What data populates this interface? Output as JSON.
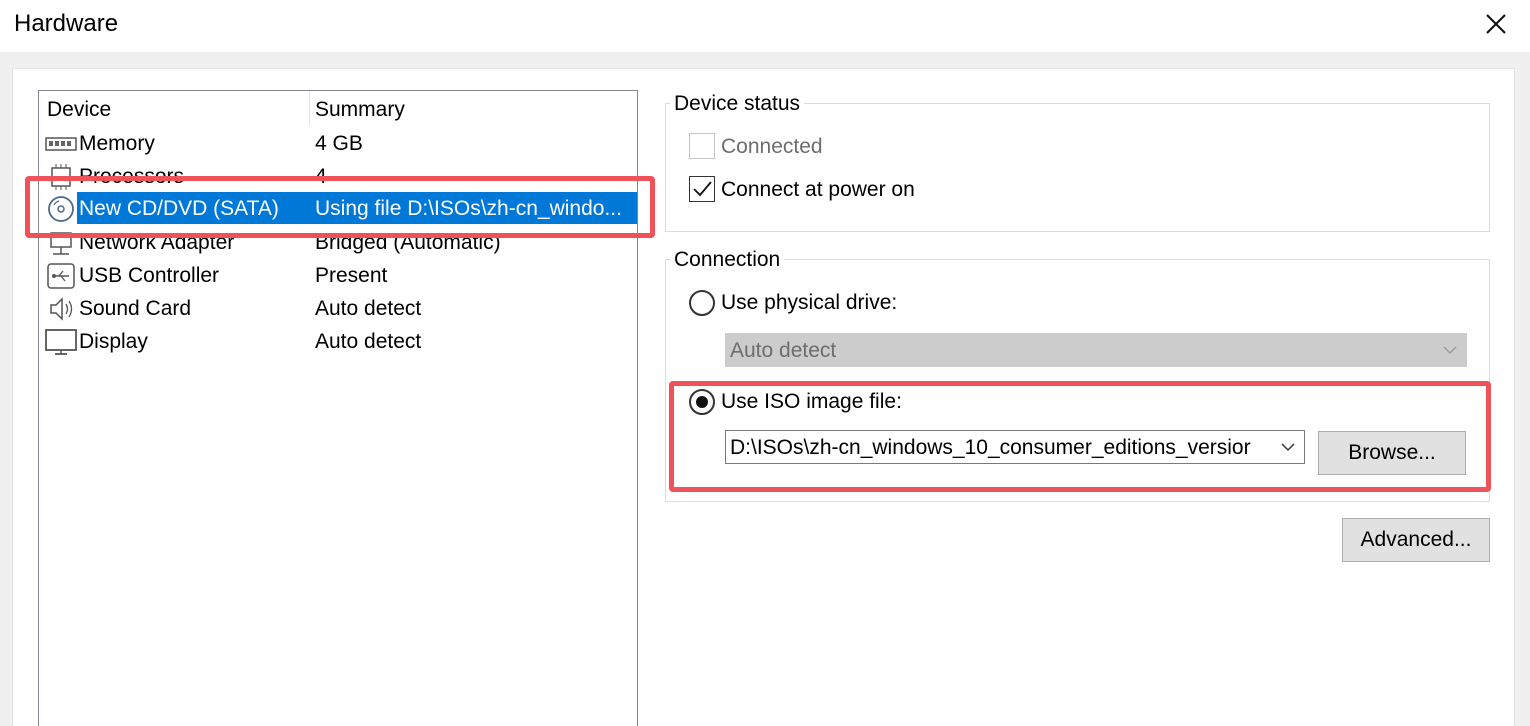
{
  "window": {
    "title": "Hardware",
    "close_icon": "close-icon"
  },
  "device_list": {
    "columns": [
      "Device",
      "Summary"
    ],
    "rows": [
      {
        "icon": "memory-icon",
        "name": "Memory",
        "summary": "4 GB"
      },
      {
        "icon": "processor-icon",
        "name": "Processors",
        "summary": "4"
      },
      {
        "icon": "cd-dvd-icon",
        "name": "New CD/DVD (SATA)",
        "summary": "Using file D:\\ISOs\\zh-cn_windo...",
        "selected": true
      },
      {
        "icon": "network-icon",
        "name": "Network Adapter",
        "summary": "Bridged (Automatic)"
      },
      {
        "icon": "usb-icon",
        "name": "USB Controller",
        "summary": "Present"
      },
      {
        "icon": "speaker-icon",
        "name": "Sound Card",
        "summary": "Auto detect"
      },
      {
        "icon": "monitor-icon",
        "name": "Display",
        "summary": "Auto detect"
      }
    ]
  },
  "device_status": {
    "label": "Device status",
    "connected": {
      "label": "Connected",
      "checked": false,
      "enabled": false
    },
    "connect_at_power_on": {
      "label": "Connect at power on",
      "checked": true
    }
  },
  "connection": {
    "label": "Connection",
    "physical_drive": {
      "label": "Use physical drive:",
      "selected": false,
      "value": "Auto detect"
    },
    "iso_image": {
      "label": "Use ISO image file:",
      "selected": true,
      "value": "D:\\ISOs\\zh-cn_windows_10_consumer_editions_versior"
    },
    "browse_label": "Browse..."
  },
  "advanced_label": "Advanced...",
  "colors": {
    "selection": "#0078d7",
    "highlight": "#f0525a"
  }
}
